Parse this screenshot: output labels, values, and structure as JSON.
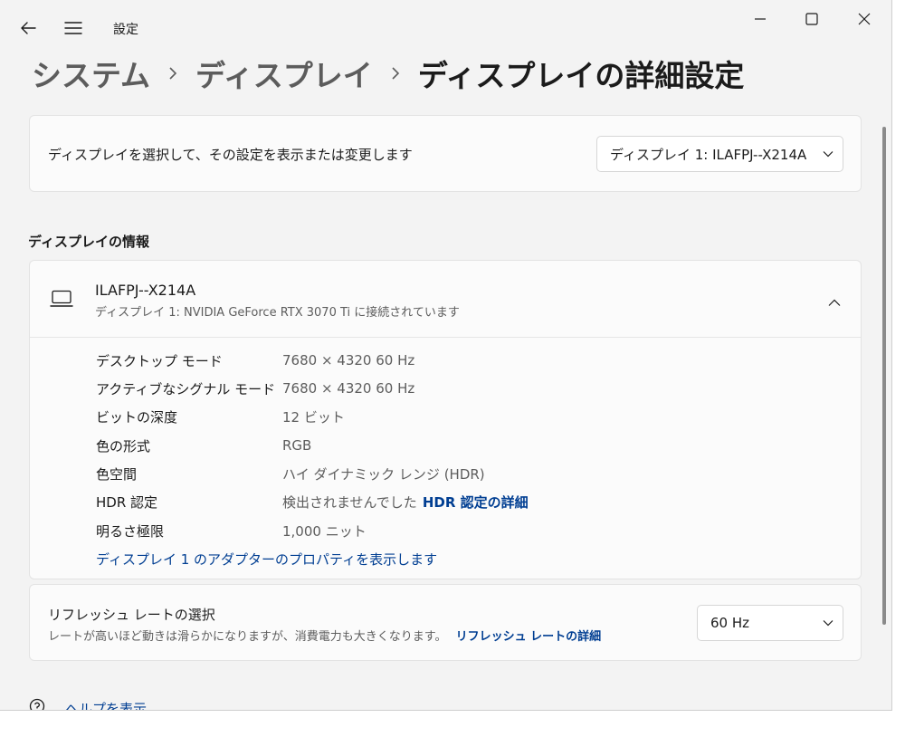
{
  "window": {
    "title": "設定"
  },
  "breadcrumb": {
    "items": [
      "システム",
      "ディスプレイ"
    ],
    "current": "ディスプレイの詳細設定"
  },
  "display_select": {
    "label": "ディスプレイを選択して、その設定を表示または変更します",
    "selected": "ディスプレイ 1: ILAFPJ--X214A"
  },
  "display_info": {
    "heading": "ディスプレイの情報",
    "monitor_name": "ILAFPJ--X214A",
    "monitor_sub": "ディスプレイ 1: NVIDIA GeForce RTX 3070 Ti に接続されています",
    "rows": [
      {
        "label": "デスクトップ モード",
        "value": "7680 × 4320 60 Hz"
      },
      {
        "label": "アクティブなシグナル モード",
        "value": "7680 × 4320 60 Hz"
      },
      {
        "label": "ビットの深度",
        "value": "12 ビット"
      },
      {
        "label": "色の形式",
        "value": "RGB"
      },
      {
        "label": "色空間",
        "value": "ハイ ダイナミック レンジ (HDR)"
      },
      {
        "label": "HDR 認定",
        "value": "検出されませんでした",
        "link": "HDR 認定の詳細"
      },
      {
        "label": "明るさ極限",
        "value": "1,000 ニット"
      }
    ],
    "adapter_link": "ディスプレイ 1 のアダプターのプロパティを表示します"
  },
  "refresh": {
    "title": "リフレッシュ レートの選択",
    "desc": "レートが高いほど動きは滑らかになりますが、消費電力も大きくなります。",
    "link": "リフレッシュ レートの詳細",
    "selected": "60 Hz"
  },
  "help": {
    "label": "ヘルプを表示"
  },
  "icons": {
    "back": "back-arrow-icon",
    "menu": "hamburger-menu-icon",
    "minimize": "minimize-icon",
    "maximize": "maximize-icon",
    "close": "close-icon",
    "monitor": "laptop-icon",
    "collapse": "chevron-up-icon",
    "dropdown": "chevron-down-icon",
    "help": "help-icon"
  },
  "colors": {
    "accent_link": "#003e92",
    "window_bg": "#f3f3f3",
    "card_bg": "#fbfbfb"
  }
}
